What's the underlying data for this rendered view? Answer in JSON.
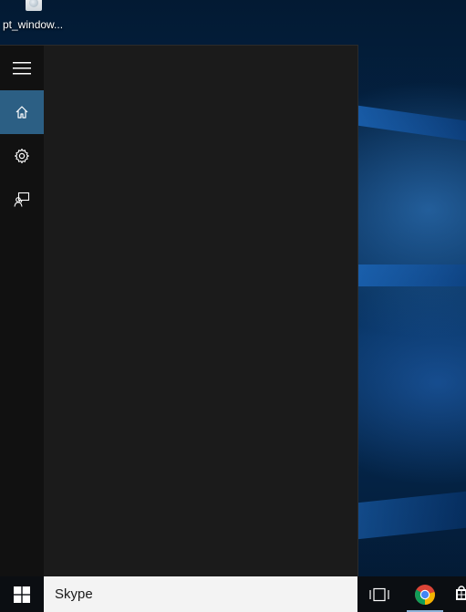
{
  "desktop": {
    "icon_label": "pt_window..."
  },
  "rail": {
    "items": [
      {
        "name": "menu",
        "icon": "hamburger-menu-icon",
        "active": false
      },
      {
        "name": "home",
        "icon": "home-icon",
        "active": true
      },
      {
        "name": "settings",
        "icon": "gear-icon",
        "active": false
      },
      {
        "name": "feedback",
        "icon": "feedback-icon",
        "active": false
      }
    ]
  },
  "taskbar": {
    "search_value": "Skype",
    "pinned": [
      "start-windows-icon",
      "task-view-icon",
      "chrome-icon",
      "store-icon"
    ]
  },
  "colors": {
    "panel_bg": "#1b1b1b",
    "rail_bg": "#111111",
    "rail_active": "#2c5f84",
    "taskbar_bg": "#0b0e12",
    "search_bg": "#f3f3f3"
  }
}
